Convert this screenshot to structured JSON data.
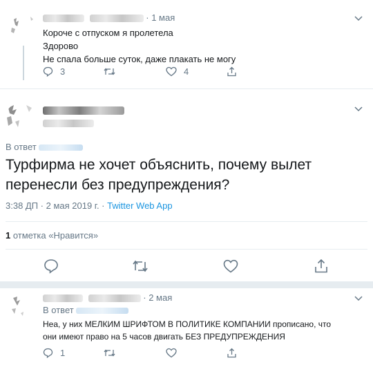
{
  "tweet1": {
    "date": "· 1 мая",
    "lines": [
      "Короче с отпуском я пролетела",
      "Здорово",
      "Не спала больше суток, даже плакать не могу"
    ],
    "replies": "3",
    "likes": "4"
  },
  "tweet2": {
    "reply_label": "В ответ",
    "text_line1": "Турфирма не хочет объяснить, почему вылет",
    "text_line2": "перенесли без предупреждения?",
    "timestamp": "3:38 ДП · 2 мая 2019 г. · ",
    "source": "Twitter Web App",
    "likes_count": "1",
    "likes_label": " отметка «Нравится»"
  },
  "tweet3": {
    "date": "· 2 мая",
    "reply_label": "В ответ",
    "line1": "Неа, у них МЕЛКИМ ШРИФТОМ В ПОЛИТИКЕ КОМПАНИИ прописано, что",
    "line2": "они имеют право на 5 часов двигать БЕЗ ПРЕДУПРЕЖДЕНИЯ",
    "replies": "1"
  },
  "colors": {
    "text": "#14171a",
    "muted": "#657786",
    "link": "#1b95e0",
    "divider": "#e6ecf0"
  }
}
